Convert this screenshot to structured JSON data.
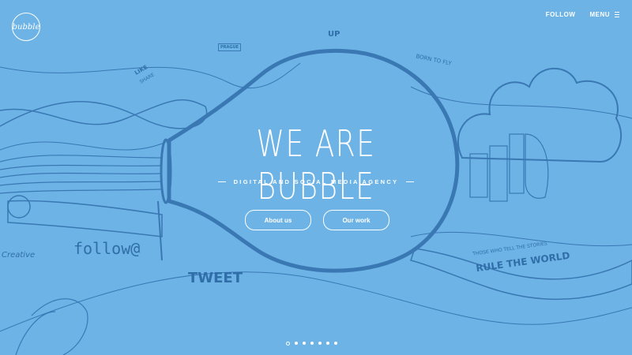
{
  "brand": {
    "logo_text": "bubble"
  },
  "nav": {
    "follow_label": "FOLLOW",
    "menu_label": "MENU"
  },
  "hero": {
    "title": "WE ARE BUBBLE",
    "subtitle": "DIGITAL AND SOCIAL MEDIA AGENCY",
    "buttons": {
      "about": "About us",
      "work": "Our work"
    }
  },
  "illustration": {
    "up": "UP",
    "prague": "PRAGUE",
    "like": "LIKE",
    "share": "SHARE",
    "born_to_fly": "BORN TO FLY",
    "follow": "follow@",
    "creative": "Creative",
    "tweet": "TWEET",
    "stories_1": "THOSE WHO TELL THE STORIES",
    "stories_2": "RULE THE WORLD"
  },
  "pagination": {
    "total": 7,
    "active_index": 0
  },
  "colors": {
    "background": "#6db3e6",
    "line": "#3a78b4",
    "text": "#ffffff"
  }
}
